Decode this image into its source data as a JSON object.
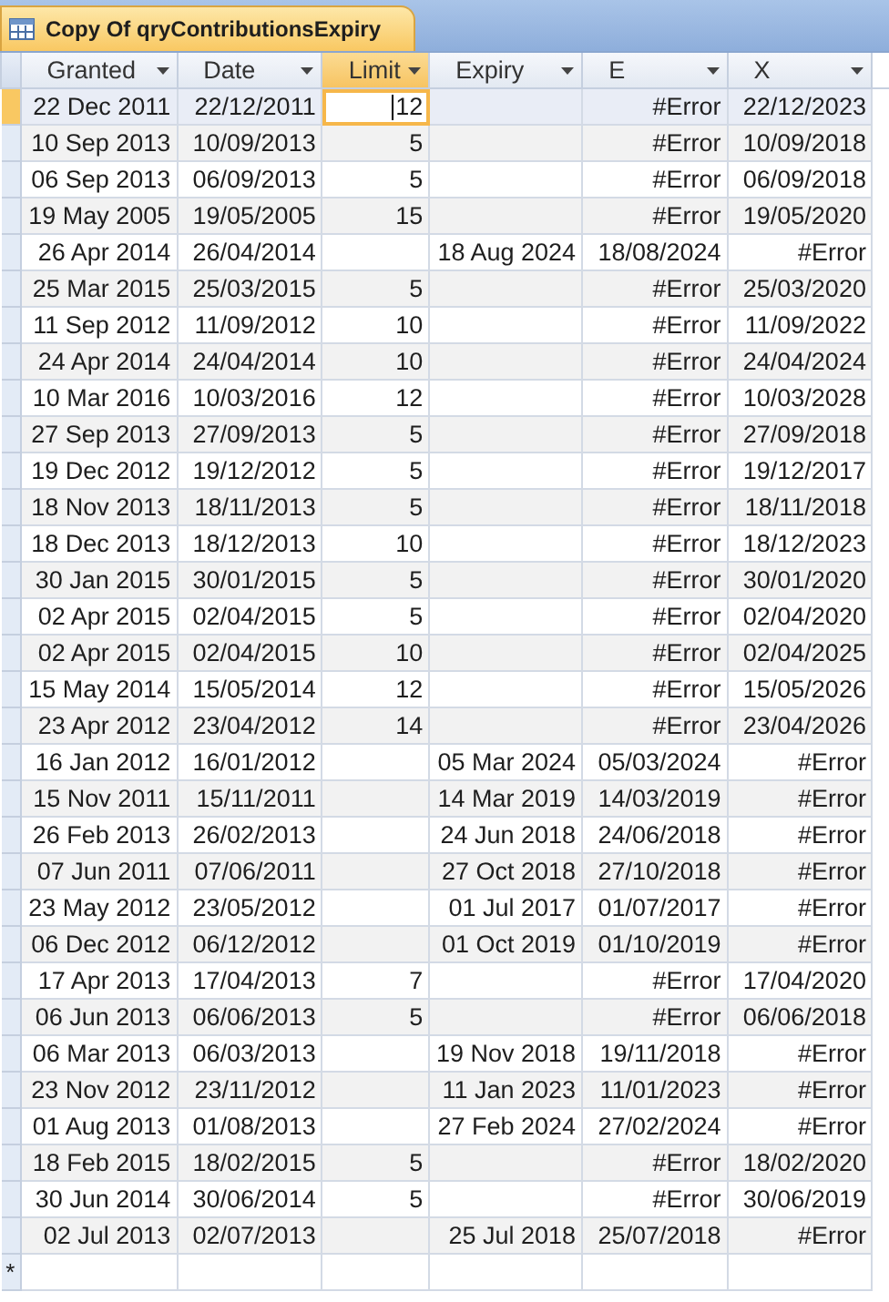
{
  "tab": {
    "title": "Copy Of qryContributionsExpiry",
    "selected": true
  },
  "columns": [
    {
      "label": "Granted",
      "selected": false
    },
    {
      "label": "Date",
      "selected": false
    },
    {
      "label": "Limit",
      "selected": true
    },
    {
      "label": "Expiry",
      "selected": false
    },
    {
      "label": "E",
      "selected": false
    },
    {
      "label": "X",
      "selected": false
    }
  ],
  "rows": [
    {
      "selected": true,
      "cells": [
        "22 Dec 2011",
        "22/12/2011",
        "12",
        null,
        "#Error",
        "22/12/2023"
      ]
    },
    {
      "selected": false,
      "cells": [
        "10 Sep 2013",
        "10/09/2013",
        "5",
        null,
        "#Error",
        "10/09/2018"
      ]
    },
    {
      "selected": false,
      "cells": [
        "06 Sep 2013",
        "06/09/2013",
        "5",
        null,
        "#Error",
        "06/09/2018"
      ]
    },
    {
      "selected": false,
      "cells": [
        "19 May 2005",
        "19/05/2005",
        "15",
        null,
        "#Error",
        "19/05/2020"
      ]
    },
    {
      "selected": false,
      "cells": [
        "26 Apr 2014",
        "26/04/2014",
        null,
        "18 Aug 2024",
        "18/08/2024",
        "#Error"
      ]
    },
    {
      "selected": false,
      "cells": [
        "25 Mar 2015",
        "25/03/2015",
        "5",
        null,
        "#Error",
        "25/03/2020"
      ]
    },
    {
      "selected": false,
      "cells": [
        "11 Sep 2012",
        "11/09/2012",
        "10",
        null,
        "#Error",
        "11/09/2022"
      ]
    },
    {
      "selected": false,
      "cells": [
        "24 Apr 2014",
        "24/04/2014",
        "10",
        null,
        "#Error",
        "24/04/2024"
      ]
    },
    {
      "selected": false,
      "cells": [
        "10 Mar 2016",
        "10/03/2016",
        "12",
        null,
        "#Error",
        "10/03/2028"
      ]
    },
    {
      "selected": false,
      "cells": [
        "27 Sep 2013",
        "27/09/2013",
        "5",
        null,
        "#Error",
        "27/09/2018"
      ]
    },
    {
      "selected": false,
      "cells": [
        "19 Dec 2012",
        "19/12/2012",
        "5",
        null,
        "#Error",
        "19/12/2017"
      ]
    },
    {
      "selected": false,
      "cells": [
        "18 Nov 2013",
        "18/11/2013",
        "5",
        null,
        "#Error",
        "18/11/2018"
      ]
    },
    {
      "selected": false,
      "cells": [
        "18 Dec 2013",
        "18/12/2013",
        "10",
        null,
        "#Error",
        "18/12/2023"
      ]
    },
    {
      "selected": false,
      "cells": [
        "30 Jan 2015",
        "30/01/2015",
        "5",
        null,
        "#Error",
        "30/01/2020"
      ]
    },
    {
      "selected": false,
      "cells": [
        "02 Apr 2015",
        "02/04/2015",
        "5",
        null,
        "#Error",
        "02/04/2020"
      ]
    },
    {
      "selected": false,
      "cells": [
        "02 Apr 2015",
        "02/04/2015",
        "10",
        null,
        "#Error",
        "02/04/2025"
      ]
    },
    {
      "selected": false,
      "cells": [
        "15 May 2014",
        "15/05/2014",
        "12",
        null,
        "#Error",
        "15/05/2026"
      ]
    },
    {
      "selected": false,
      "cells": [
        "23 Apr 2012",
        "23/04/2012",
        "14",
        null,
        "#Error",
        "23/04/2026"
      ]
    },
    {
      "selected": false,
      "cells": [
        "16 Jan 2012",
        "16/01/2012",
        null,
        "05 Mar 2024",
        "05/03/2024",
        "#Error"
      ]
    },
    {
      "selected": false,
      "cells": [
        "15 Nov 2011",
        "15/11/2011",
        null,
        "14 Mar 2019",
        "14/03/2019",
        "#Error"
      ]
    },
    {
      "selected": false,
      "cells": [
        "26 Feb 2013",
        "26/02/2013",
        null,
        "24 Jun 2018",
        "24/06/2018",
        "#Error"
      ]
    },
    {
      "selected": false,
      "cells": [
        "07 Jun 2011",
        "07/06/2011",
        null,
        "27 Oct 2018",
        "27/10/2018",
        "#Error"
      ]
    },
    {
      "selected": false,
      "cells": [
        "23 May 2012",
        "23/05/2012",
        null,
        "01 Jul 2017",
        "01/07/2017",
        "#Error"
      ]
    },
    {
      "selected": false,
      "cells": [
        "06 Dec 2012",
        "06/12/2012",
        null,
        "01 Oct 2019",
        "01/10/2019",
        "#Error"
      ]
    },
    {
      "selected": false,
      "cells": [
        "17 Apr 2013",
        "17/04/2013",
        "7",
        null,
        "#Error",
        "17/04/2020"
      ]
    },
    {
      "selected": false,
      "cells": [
        "06 Jun 2013",
        "06/06/2013",
        "5",
        null,
        "#Error",
        "06/06/2018"
      ]
    },
    {
      "selected": false,
      "cells": [
        "06 Mar 2013",
        "06/03/2013",
        null,
        "19 Nov 2018",
        "19/11/2018",
        "#Error"
      ]
    },
    {
      "selected": false,
      "cells": [
        "23 Nov 2012",
        "23/11/2012",
        null,
        "11 Jan 2023",
        "11/01/2023",
        "#Error"
      ]
    },
    {
      "selected": false,
      "cells": [
        "01 Aug 2013",
        "01/08/2013",
        null,
        "27 Feb 2024",
        "27/02/2024",
        "#Error"
      ]
    },
    {
      "selected": false,
      "cells": [
        "18 Feb 2015",
        "18/02/2015",
        "5",
        null,
        "#Error",
        "18/02/2020"
      ]
    },
    {
      "selected": false,
      "cells": [
        "30 Jun 2014",
        "30/06/2014",
        "5",
        null,
        "#Error",
        "30/06/2019"
      ]
    },
    {
      "selected": false,
      "cells": [
        "02 Jul 2013",
        "02/07/2013",
        null,
        "25 Jul 2018",
        "25/07/2018",
        "#Error"
      ]
    }
  ],
  "new_row_marker": "*"
}
